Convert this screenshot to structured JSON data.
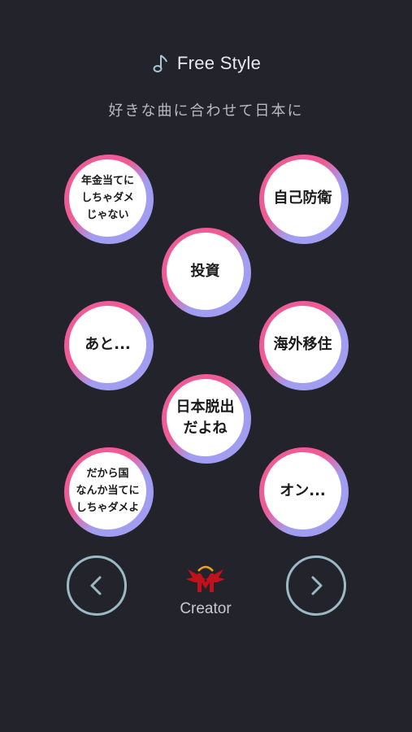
{
  "header": {
    "title": "Free Style",
    "icon": "music-note-icon",
    "subtitle": "好きな曲に合わせて日本に"
  },
  "bubbles": [
    {
      "label": "年金当てに\nしちゃダメ\nじゃない"
    },
    {
      "label": "自己防衛"
    },
    {
      "label": "投資"
    },
    {
      "label": "あと..."
    },
    {
      "label": "海外移住"
    },
    {
      "label": "日本脱出\nだよね"
    },
    {
      "label": "だから国\nなんか当てに\nしちゃダメよ"
    },
    {
      "label": "オン..."
    }
  ],
  "nav": {
    "prev_icon": "chevron-left-icon",
    "next_icon": "chevron-right-icon"
  },
  "creator": {
    "label": "Creator",
    "icon": "creator-logo-icon"
  },
  "colors": {
    "background": "#22232b",
    "pink": "#ef5b97",
    "lavender": "#a19ef2",
    "nav_ring": "#9bbac6"
  }
}
